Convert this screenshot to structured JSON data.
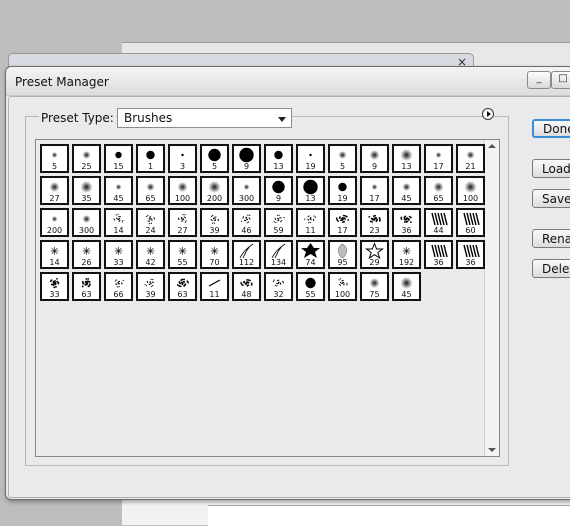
{
  "dialog": {
    "title": "Preset Manager",
    "preset_type_label": "Preset Type:",
    "preset_type_value": "Brushes",
    "background_close": "×"
  },
  "window_controls": {
    "minimize": "_",
    "maximize": "□"
  },
  "buttons": {
    "done": "Done",
    "load": "Load...",
    "save_set": "Save Set...",
    "rename": "Rename...",
    "delete": "Delete"
  },
  "brush_rows": [
    [
      {
        "size": "5",
        "shape": "soft"
      },
      {
        "size": "25",
        "shape": "soft"
      },
      {
        "size": "15",
        "shape": "hard"
      },
      {
        "size": "1",
        "shape": "hard"
      },
      {
        "size": "3",
        "shape": "hard"
      },
      {
        "size": "5",
        "shape": "hard"
      },
      {
        "size": "9",
        "shape": "hard"
      },
      {
        "size": "13",
        "shape": "hard"
      },
      {
        "size": "19",
        "shape": "hard"
      },
      {
        "size": "5",
        "shape": "soft"
      },
      {
        "size": "9",
        "shape": "soft"
      },
      {
        "size": "13",
        "shape": "soft"
      },
      {
        "size": "17",
        "shape": "soft"
      },
      {
        "size": "21",
        "shape": "soft"
      }
    ],
    [
      {
        "size": "27",
        "shape": "soft"
      },
      {
        "size": "35",
        "shape": "soft"
      },
      {
        "size": "45",
        "shape": "soft"
      },
      {
        "size": "65",
        "shape": "soft"
      },
      {
        "size": "100",
        "shape": "soft"
      },
      {
        "size": "200",
        "shape": "soft"
      },
      {
        "size": "300",
        "shape": "soft"
      },
      {
        "size": "9",
        "shape": "hard"
      },
      {
        "size": "13",
        "shape": "hard"
      },
      {
        "size": "19",
        "shape": "hard"
      },
      {
        "size": "17",
        "shape": "soft"
      },
      {
        "size": "45",
        "shape": "soft"
      },
      {
        "size": "65",
        "shape": "soft"
      },
      {
        "size": "100",
        "shape": "soft"
      }
    ],
    [
      {
        "size": "200",
        "shape": "soft"
      },
      {
        "size": "300",
        "shape": "soft"
      },
      {
        "size": "14",
        "shape": "splatter"
      },
      {
        "size": "24",
        "shape": "spray"
      },
      {
        "size": "27",
        "shape": "spray"
      },
      {
        "size": "39",
        "shape": "spray"
      },
      {
        "size": "46",
        "shape": "spray"
      },
      {
        "size": "59",
        "shape": "spray"
      },
      {
        "size": "11",
        "shape": "splatter"
      },
      {
        "size": "17",
        "shape": "texture"
      },
      {
        "size": "23",
        "shape": "texture"
      },
      {
        "size": "36",
        "shape": "texture"
      },
      {
        "size": "44",
        "shape": "stripes"
      },
      {
        "size": "60",
        "shape": "stripes"
      }
    ],
    [
      {
        "size": "14",
        "shape": "star-burst"
      },
      {
        "size": "26",
        "shape": "star-burst"
      },
      {
        "size": "33",
        "shape": "star-burst"
      },
      {
        "size": "42",
        "shape": "star-burst"
      },
      {
        "size": "55",
        "shape": "star-burst"
      },
      {
        "size": "70",
        "shape": "star-burst"
      },
      {
        "size": "112",
        "shape": "grass"
      },
      {
        "size": "134",
        "shape": "grass"
      },
      {
        "size": "74",
        "shape": "leaf"
      },
      {
        "size": "95",
        "shape": "leaf-light"
      },
      {
        "size": "29",
        "shape": "star"
      },
      {
        "size": "192",
        "shape": "star-burst"
      },
      {
        "size": "36",
        "shape": "stripes"
      },
      {
        "size": "36",
        "shape": "stripes"
      }
    ],
    [
      {
        "size": "33",
        "shape": "texture"
      },
      {
        "size": "63",
        "shape": "texture"
      },
      {
        "size": "66",
        "shape": "spray"
      },
      {
        "size": "39",
        "shape": "spray"
      },
      {
        "size": "63",
        "shape": "texture"
      },
      {
        "size": "11",
        "shape": "stroke"
      },
      {
        "size": "48",
        "shape": "texture"
      },
      {
        "size": "32",
        "shape": "splatter"
      },
      {
        "size": "55",
        "shape": "hard"
      },
      {
        "size": "100",
        "shape": "spray"
      },
      {
        "size": "75",
        "shape": "soft"
      },
      {
        "size": "45",
        "shape": "soft"
      }
    ]
  ],
  "colors": {
    "accent": "#3a8dd8",
    "dialog_bg": "#eaeaea",
    "cell_border": "#111111"
  }
}
